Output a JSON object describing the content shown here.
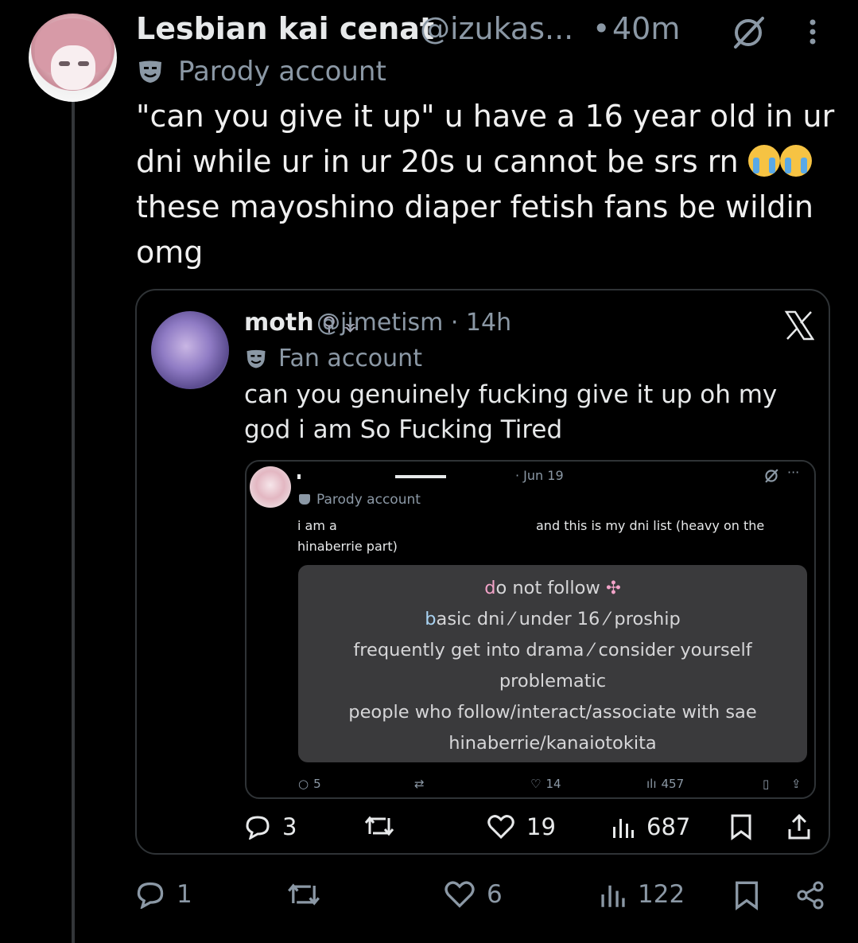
{
  "post": {
    "display_name": "Lesbian kai cenat",
    "handle": "@izukas...",
    "separator": "•",
    "time": "40m",
    "badge_label": "Parody account",
    "text_line1": "\"can you give it up\" u have a 16 year old in ur",
    "text_line2": "dni while ur in ur 20s u cannot be srs rn",
    "text_line3": "these mayoshino diaper fetish fans be wildin",
    "text_line4": "omg",
    "emojis": [
      "loudly-crying-face-emoji",
      "loudly-crying-face-emoji"
    ],
    "actions": {
      "replies": "1",
      "reposts": "",
      "likes": "6",
      "views": "122"
    }
  },
  "quote": {
    "display_name": "moth",
    "name_symbol": "𓃴",
    "handle_time": "@jimetism · 14h",
    "badge_label": "Fan account",
    "text": "can you genuinely fucking give it up oh my god i am So Fucking Tired",
    "actions": {
      "replies": "3",
      "reposts": "",
      "likes": "19",
      "views": "687"
    }
  },
  "inner_quote": {
    "time": "· Jun 19",
    "more": "···",
    "badge_label": "Parody account",
    "text_left": "i am a",
    "text_left2": "hinaberrie part)",
    "text_right": "and this is my dni list (heavy on the",
    "card": {
      "line1_first": "d",
      "line1_rest": "o not follow",
      "line2_first": "b",
      "line2_rest": "asic dni ⁄ under 16 ⁄ proship",
      "line3": "frequently get into drama ⁄ consider yourself",
      "line4": "problematic",
      "line5": "people who follow/interact/associate with sae",
      "line6": "hinaberrie/kanaiotokita"
    },
    "actions": {
      "replies": "5",
      "reposts": "",
      "likes": "14",
      "views": "457"
    }
  },
  "colors": {
    "background": "#000000",
    "text": "#e7e9ea",
    "muted": "#8b98a5",
    "border": "#2f3336",
    "card": "#3a3a3c",
    "pink_accent": "#f2a3c8"
  }
}
